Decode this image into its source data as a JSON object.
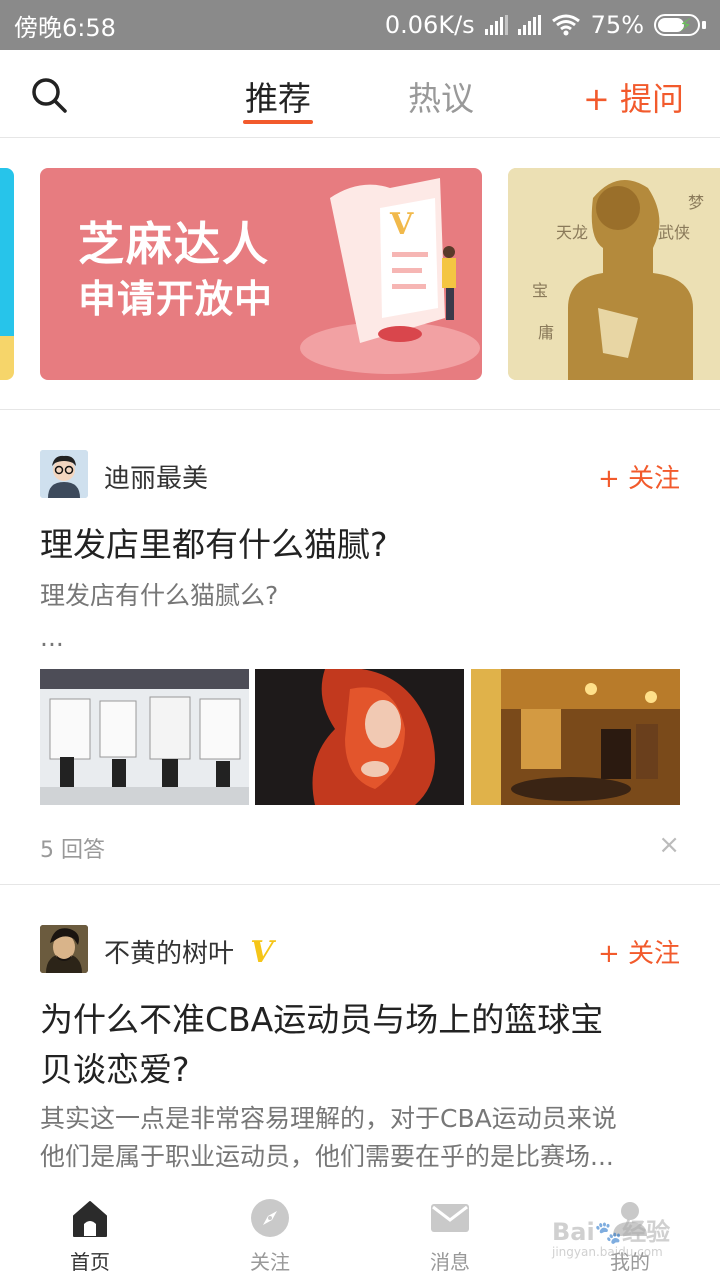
{
  "status_bar": {
    "time": "傍晚6:58",
    "network_speed": "0.06K/s",
    "battery": "75%"
  },
  "top_nav": {
    "tabs": [
      {
        "label": "推荐",
        "active": true
      },
      {
        "label": "热议",
        "active": false
      }
    ],
    "ask_label": "+ 提问"
  },
  "banners": {
    "main": {
      "line1": "芝麻达人",
      "line2": "申请开放中"
    }
  },
  "feed": [
    {
      "username": "迪丽最美",
      "verified": false,
      "follow_label": "+ 关注",
      "title": "理发店里都有什么猫腻?",
      "summary_line1": "理发店有什么猫腻么?",
      "summary_line2": "...",
      "answers": "5 回答",
      "close": "×"
    },
    {
      "username": "不黄的树叶",
      "verified": true,
      "follow_label": "+ 关注",
      "title_line1": "为什么不准CBA运动员与场上的篮球宝",
      "title_line2": "贝谈恋爱?",
      "summary_line1": "其实这一点是非常容易理解的，对于CBA运动员来说",
      "summary_line2": "他们是属于职业运动员，他们需要在乎的是比赛场..."
    }
  ],
  "bottom_nav": [
    {
      "label": "首页",
      "icon": "home-icon",
      "active": true
    },
    {
      "label": "关注",
      "icon": "compass-icon",
      "active": false
    },
    {
      "label": "消息",
      "icon": "mail-icon",
      "active": false
    },
    {
      "label": "我的",
      "icon": "user-icon",
      "active": false
    }
  ],
  "colors": {
    "accent": "#f25a2c",
    "status_bar": "#8a8a8a",
    "verified": "#f5c518"
  }
}
